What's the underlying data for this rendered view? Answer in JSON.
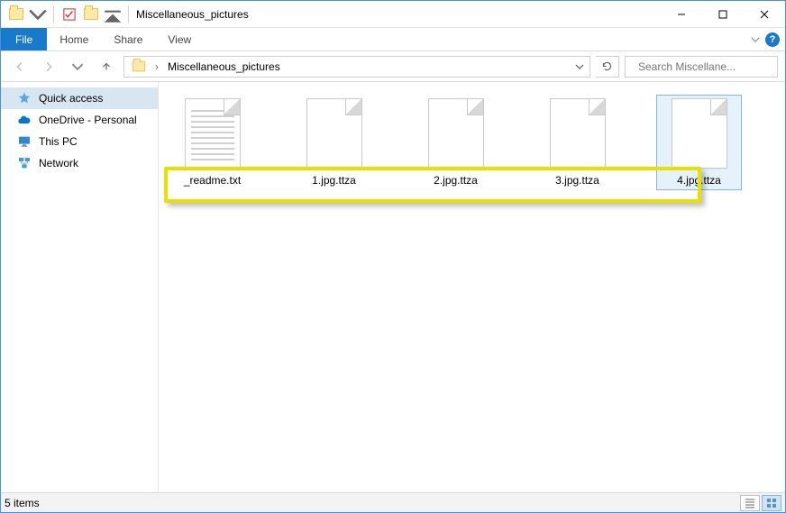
{
  "title": "Miscellaneous_pictures",
  "ribbon": {
    "file": "File",
    "tabs": [
      "Home",
      "Share",
      "View"
    ]
  },
  "nav": {
    "breadcrumb": "Miscellaneous_pictures",
    "search_placeholder": "Search Miscellane..."
  },
  "sidebar": {
    "items": [
      {
        "label": "Quick access",
        "icon": "star"
      },
      {
        "label": "OneDrive - Personal",
        "icon": "cloud"
      },
      {
        "label": "This PC",
        "icon": "pc"
      },
      {
        "label": "Network",
        "icon": "network"
      }
    ]
  },
  "files": [
    {
      "name": "_readme.txt",
      "type": "text",
      "selected": false
    },
    {
      "name": "1.jpg.ttza",
      "type": "blank",
      "selected": false
    },
    {
      "name": "2.jpg.ttza",
      "type": "blank",
      "selected": false
    },
    {
      "name": "3.jpg.ttza",
      "type": "blank",
      "selected": false
    },
    {
      "name": "4.jpg.ttza",
      "type": "blank",
      "selected": true
    }
  ],
  "status": {
    "count_label": "5 items"
  }
}
